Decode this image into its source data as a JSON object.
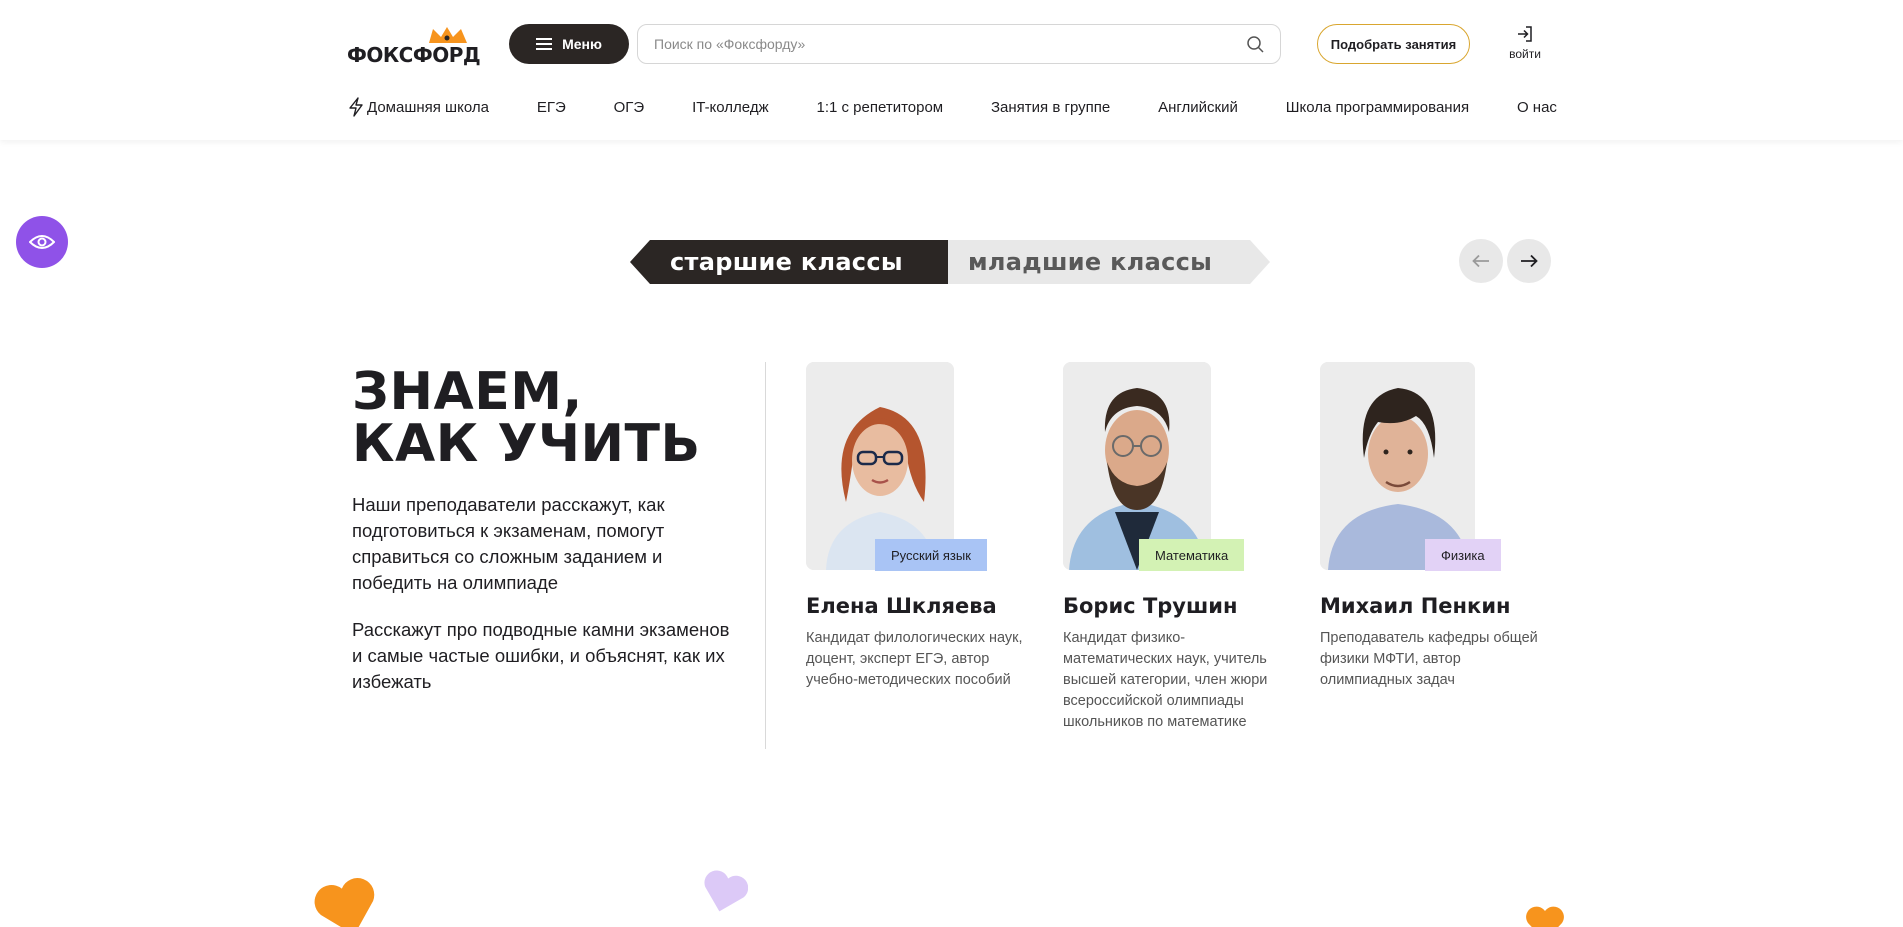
{
  "header": {
    "logo_text": "ФОКСФОРД",
    "menu_label": "Меню",
    "search_placeholder": "Поиск по «Фоксфорду»",
    "pick_button": "Подобрать занятия",
    "login_label": "войти",
    "nav": [
      "Домашняя школа",
      "ЕГЭ",
      "ОГЭ",
      "IT-колледж",
      "1:1 с репетитором",
      "Занятия в группе",
      "Английский",
      "Школа программирования",
      "О нас"
    ]
  },
  "tabs": {
    "active": "старшие классы",
    "inactive": "младшие классы"
  },
  "intro": {
    "headline_1": "ЗНАЕМ,",
    "headline_2": "КАК УЧИТЬ",
    "paragraph_1": "Наши преподаватели расскажут, как подготовиться к экзаменам, помогут справиться со сложным заданием и победить на олимпиаде",
    "paragraph_2": "Расскажут про подводные камни экзаменов и самые частые ошибки, и объяснят, как их избежать"
  },
  "teachers": [
    {
      "name": "Елена Шкляева",
      "subject": "Русский язык",
      "subject_color": "#a9c4f5",
      "description": "Кандидат филологических наук, доцент, эксперт ЕГЭ, автор учебно-методических пособий"
    },
    {
      "name": "Борис Трушин",
      "subject": "Математика",
      "subject_color": "#d3f2b4",
      "description": "Кандидат физико-математических наук, учитель высшей категории, член жюри всероссийской олимпиады школьников по математике"
    },
    {
      "name": "Михаил Пенкин",
      "subject": "Физика",
      "subject_color": "#e2d2f6",
      "description": "Преподаватель кафедры общей физики МФТИ, автор олимпиадных задач"
    }
  ],
  "colors": {
    "accent_dark": "#2b2624",
    "accent_gold": "#d9a62f",
    "eye_purple": "#8f52e8",
    "heart_orange": "#f7941d",
    "heart_lilac": "#dcc9f7"
  },
  "icons": [
    "menu-icon",
    "search-icon",
    "login-icon",
    "bolt-icon",
    "eye-icon",
    "arrow-left-icon",
    "arrow-right-icon"
  ]
}
